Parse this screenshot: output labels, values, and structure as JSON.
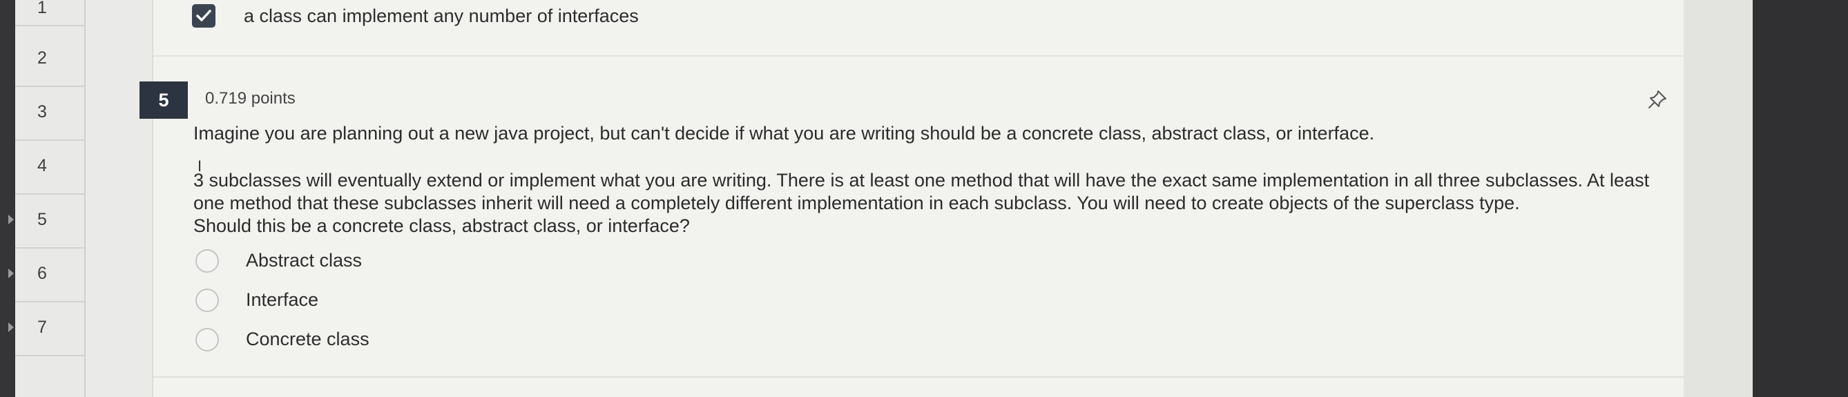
{
  "nav": {
    "items": [
      {
        "label": "1"
      },
      {
        "label": "2"
      },
      {
        "label": "3"
      },
      {
        "label": "4"
      },
      {
        "label": "5"
      },
      {
        "label": "6"
      },
      {
        "label": "7"
      }
    ]
  },
  "previous_question": {
    "selected_answer": "a class can implement any number of interfaces"
  },
  "question": {
    "number": "5",
    "points": "0.719 points",
    "prompt_line1": "Imagine you are planning out a new java project, but can't decide if what you are writing should be a concrete class, abstract class, or interface.",
    "prompt_line2": "3 subclasses will eventually extend or implement what you are writing.  There is at least one method that will have the exact same implementation in all three subclasses. At least",
    "prompt_line3": "one method that these subclasses inherit will need a completely different implementation in each subclass.  You will need to create objects of the superclass type.",
    "prompt_line4": "Should this be a concrete class, abstract class, or interface?",
    "options": [
      {
        "label": "Abstract class"
      },
      {
        "label": "Interface"
      },
      {
        "label": "Concrete class"
      }
    ]
  },
  "icons": {
    "checkbox": "check-icon",
    "pin": "pin-icon",
    "cursor": "text-cursor-icon"
  },
  "colors": {
    "question_badge": "#2b3440",
    "checkbox": "#3b4450",
    "card_background": "#f2f2ef"
  }
}
